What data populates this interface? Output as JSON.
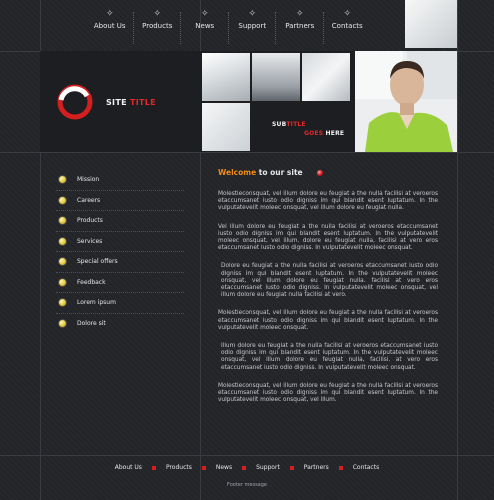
{
  "nav": {
    "items": [
      "About Us",
      "Products",
      "News",
      "Support",
      "Partners",
      "Contacts"
    ]
  },
  "header": {
    "site_title_main": "SITE ",
    "site_title_accent": "TITLE",
    "subtitle_1a": "SUB",
    "subtitle_1b": "TITLE",
    "subtitle_2a": "GOES ",
    "subtitle_2b": "HERE"
  },
  "sidebar": {
    "items": [
      "Mission",
      "Careers",
      "Products",
      "Services",
      "Special offers",
      "Feedback",
      "Lorem ipsum",
      "Dolore sit"
    ]
  },
  "content": {
    "welcome_a": "Welcome",
    "welcome_b": " to our site",
    "paragraphs": [
      "Molestieconsquat, vel illum dolore eu feugiat a the nulla facilisi at veroeros etaccumsanet iusto odio digniss im qui blandit esent luptatum. In the vulputatevelit moleec onsquat, vel illum dolore eu feugiat nulla.",
      "Vel illum dolore eu feugiat a the nulla facilisi at veroeros etaccumsanet iusto odio digniss im qui blandit esent luptatum. In the vulputatevelit moleec onsquat, vel illum. dolore eu feugiat nulla, facilisi at vero eros etaccumsanet iusto odio digniss. In vulputatevelit moleec onsquat.",
      "Dolore eu feugiat a the nulla facilisi at veroeros etaccumsanet iusto odio digniss im qui blandit esent luptatum. In the vulputatevelit moleec onsquat, vel illum dolore eu feugiat nulla. facilisi at vero eros etaccumsanet iusto odio digniss. In vulputatevelit moleec onsquat, vel illum dolore eu feugiat nulla facilisi at vero.",
      "Molestieconsquat, vel illum dolore eu feugiat a the nulla facilisi at veroeros etaccumsanet iusto odio digniss im qui blandit esent luptatum. In the vulputatevelit moleec onsquat.",
      "Illum dolore eu feugiat a the nulla facilisi at veroeros etaccumsanet iusto odio digniss im qui blandit esent luptatum. In the vulputatevelit moleec onsquat, vel illum dolore eu feugiat nulla, facilisi. at vero eros etaccumsanet iusto odio digniss. In vulputatevelit moleec onsquat.",
      "Molestieconsquat, vel illum dolore eu feugiat a the nulla facilisi at veroeros etaccumsanet iusto odio digniss im qui blandit esent luptatum. In the vulputatevelit moleec onsquat, vel illum."
    ]
  },
  "footer": {
    "links": [
      "About Us",
      "Products",
      "News",
      "Support",
      "Partners",
      "Contacts"
    ],
    "message": "Footer message"
  },
  "colors": {
    "accent_red": "#e0282a",
    "welcome_orange": "#f08a1a",
    "background": "#232428"
  }
}
